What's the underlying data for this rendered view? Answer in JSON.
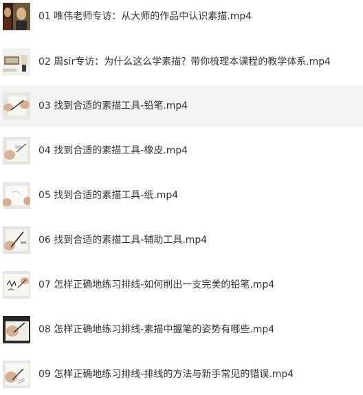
{
  "videos": [
    {
      "title": "01 唯伟老师专访：从大师的作品中认识素描.mp4",
      "thumb": "portraits"
    },
    {
      "title": "02 周sir专访：为什么这么学素描？带你梳理本课程的教学体系.mp4",
      "thumb": "desk-objects"
    },
    {
      "title": "03 找到合适的素描工具-铅笔.mp4",
      "thumb": "hands-pencil"
    },
    {
      "title": "04 找到合适的素描工具-橡皮.mp4",
      "thumb": "hands-eraser"
    },
    {
      "title": "05 找到合适的素描工具-纸.mp4",
      "thumb": "hands-paper"
    },
    {
      "title": "06 找到合适的素描工具-辅助工具.mp4",
      "thumb": "hands-tools"
    },
    {
      "title": "07 怎样正确地练习排线-如何削出一支完美的铅笔.mp4",
      "thumb": "sketch-paper"
    },
    {
      "title": "08 怎样正确地练习排线-素描中握笔的姿势有哪些.mp4",
      "thumb": "hand-grip"
    },
    {
      "title": "09 怎样正确地练习排线-排线的方法与新手常见的错误.mp4",
      "thumb": "hand-hatching"
    }
  ],
  "colors": {
    "text": "#333333",
    "active_row": "#f4f4f4",
    "background": "#ffffff"
  }
}
